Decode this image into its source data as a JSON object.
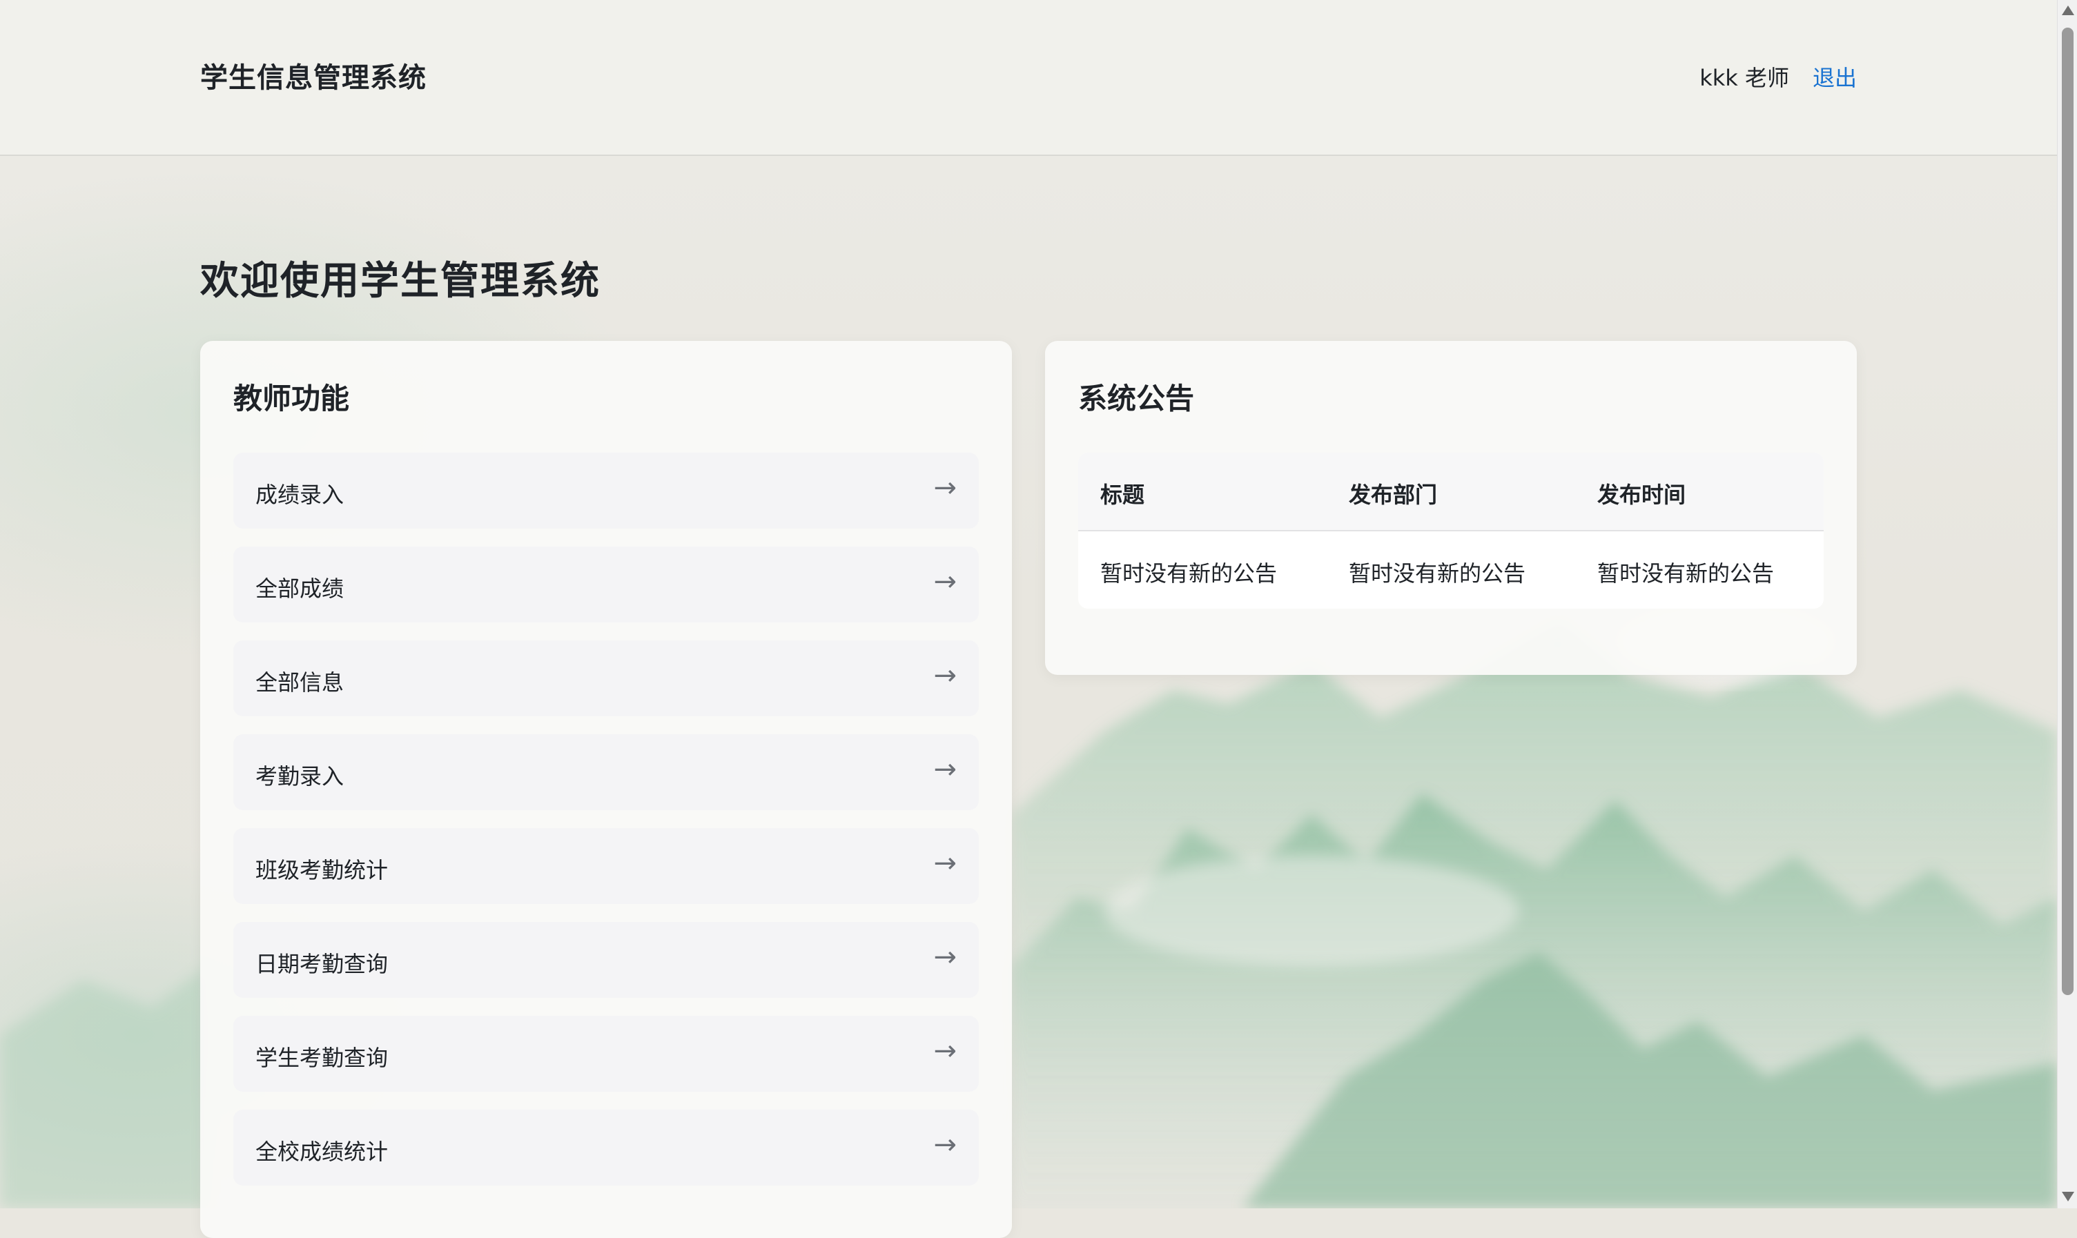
{
  "header": {
    "brand": "学生信息管理系统",
    "user_name": "kkk 老师",
    "logout_label": "退出"
  },
  "main": {
    "title": "欢迎使用学生管理系统"
  },
  "teacher_panel": {
    "title": "教师功能",
    "arrow": "→",
    "items": [
      {
        "label": "成绩录入"
      },
      {
        "label": "全部成绩"
      },
      {
        "label": "全部信息"
      },
      {
        "label": "考勤录入"
      },
      {
        "label": "班级考勤统计"
      },
      {
        "label": "日期考勤查询"
      },
      {
        "label": "学生考勤查询"
      },
      {
        "label": "全校成绩统计"
      }
    ]
  },
  "announcements": {
    "title": "系统公告",
    "columns": [
      "标题",
      "发布部门",
      "发布时间"
    ],
    "rows": [
      [
        "暂时没有新的公告",
        "暂时没有新的公告",
        "暂时没有新的公告"
      ]
    ]
  },
  "colors": {
    "accent_link": "#1a73d1",
    "text": "#1f2328",
    "mountain_green": "#8fc4a4"
  }
}
